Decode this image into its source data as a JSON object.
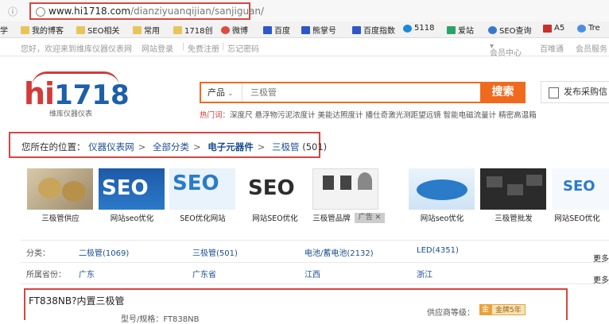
{
  "browser": {
    "url_host": "www.hi1718.com",
    "url_path": "/dianziyuanqijian/sanjiguan/",
    "bookmarks": [
      {
        "label": "学",
        "icon": "folder-icon"
      },
      {
        "label": "我的博客",
        "icon": "folder-icon"
      },
      {
        "label": "SEO相关",
        "icon": "folder-icon"
      },
      {
        "label": "常用",
        "icon": "folder-icon"
      },
      {
        "label": "1718创",
        "icon": "folder-icon"
      },
      {
        "label": "微博",
        "icon": "weibo-icon"
      },
      {
        "label": "百度",
        "icon": "paw-icon"
      },
      {
        "label": "熊掌号",
        "icon": "paw-icon"
      },
      {
        "label": "百度指数",
        "icon": "paw-icon"
      },
      {
        "label": "5118",
        "icon": "app-icon"
      },
      {
        "label": "爱站",
        "icon": "app-icon"
      },
      {
        "label": "SEO查询",
        "icon": "app-icon"
      },
      {
        "label": "A5",
        "icon": "app-icon"
      },
      {
        "label": "Tre",
        "icon": "globe-icon"
      }
    ]
  },
  "toplinks": {
    "welcome": "您好，欢迎来到维库仪器仪表网",
    "login": "网站登录",
    "register": "免费注册",
    "forgot": "忘记密码",
    "member_center": "会员中心",
    "baiwei": "百唯通",
    "member_service": "会员服务"
  },
  "header": {
    "logo_hi": "hi",
    "logo_num": "1718",
    "logo_sub": "维库仪器仪表",
    "search_category": "产品",
    "search_placeholder": "三极管",
    "search_button": "搜索",
    "hot_label": "热门词：",
    "hot_terms": "深度尺  悬浮物污泥浓度计  美能达照度计  播仕奇激光测距望远镜  智能电磁流量计  精密高温箱",
    "publish_button": "发布采购信"
  },
  "breadcrumb": {
    "prefix": "您所在的位置：",
    "items": [
      "仪器仪表网",
      "全部分类",
      "电子元器件",
      "三极管"
    ],
    "count": "(501)",
    "separator": ">"
  },
  "thumbnails": [
    {
      "caption": "三极管供应"
    },
    {
      "caption": "网站seo优化"
    },
    {
      "caption": "SEO优化网站"
    },
    {
      "caption": "网站SEO优化"
    },
    {
      "caption": "三极管品牌"
    },
    {
      "caption": "网站seo优化"
    },
    {
      "caption": "三极管批发"
    },
    {
      "caption": "网站SEO优化"
    }
  ],
  "ad_close": "广告 ✕",
  "filters": {
    "category_label": "分类：",
    "categories": [
      "二极管(1069)",
      "三极管(501)",
      "电池/蓄电池(2132)",
      "LED(4351)"
    ],
    "region_label": "所属省份：",
    "regions": [
      "广东",
      "广东省",
      "江西",
      "浙江"
    ],
    "more": "更多"
  },
  "product": {
    "title": "FT838NB?内置三极管",
    "supplier_level_label": "供应商等级：",
    "badge_mark": "金",
    "badge_text": "金牌5年",
    "model_label": "型号/规格：FT838NB"
  },
  "colors": {
    "accent_orange": "#f06a1e",
    "highlight_red": "#d9453f",
    "link_blue": "#1a4d8f"
  }
}
